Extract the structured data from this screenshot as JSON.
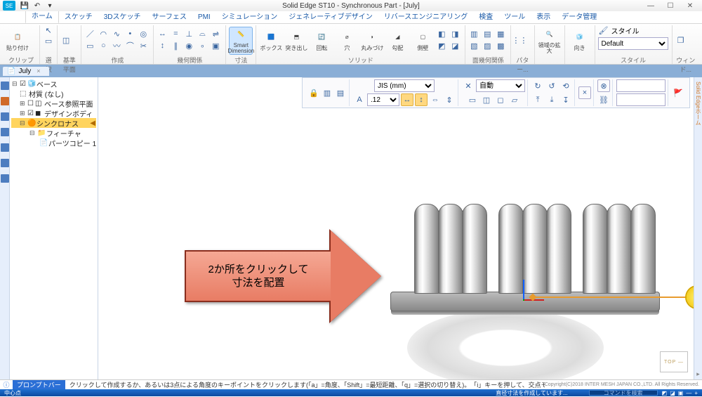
{
  "window": {
    "title": "Solid Edge ST10 - Synchronous Part - [July]",
    "min": "—",
    "max": "☐",
    "close": "✕"
  },
  "qat": {
    "save": "💾",
    "undo": "↶",
    "redo": "↷",
    "more": "▾"
  },
  "tabs": {
    "items": [
      "ホーム",
      "スケッチ",
      "3Dスケッチ",
      "サーフェス",
      "PMI",
      "シミュレーション",
      "ジェネレーティブデザイン",
      "リバースエンジニアリング",
      "検査",
      "ツール",
      "表示",
      "データ管理"
    ],
    "active": 0
  },
  "ribbon": {
    "groups": {
      "clipboard": {
        "label": "クリップボード",
        "big": "貼り付け"
      },
      "select": {
        "label": "選択"
      },
      "plane": {
        "label": "基準平面"
      },
      "create": {
        "label": "作成"
      },
      "georel": {
        "label": "幾何関係"
      },
      "dim": {
        "label": "寸法",
        "big": "Smart Dimension"
      },
      "solid": {
        "label": "ソリッド",
        "b1": "ボックス",
        "b2": "突き出し",
        "b3": "回転",
        "b4": "穴",
        "b5": "丸みづけ",
        "b6": "勾配",
        "b7": "側壁"
      },
      "facerel": {
        "label": "面幾何関係"
      },
      "pattern": {
        "label": "パター..."
      },
      "section": {
        "label": "領域の拡大"
      },
      "orient": {
        "label": "向き"
      },
      "style": {
        "label": "スタイル",
        "hdr": "スタイル",
        "val": "Default"
      },
      "window": {
        "label": "ウィンド..."
      }
    }
  },
  "doctab": {
    "name": "July",
    "open": "📄"
  },
  "tree": {
    "r0": "ベース",
    "r1": "材質 (なし)",
    "r2": "ベース参照平面",
    "r3": "デザインボディ",
    "r4": "シンクロナス",
    "r5": "フィーチャ",
    "r6": "パーツコピー 1"
  },
  "optbar": {
    "std": "JIS (mm)",
    "auto": "自動",
    "ht": ".12"
  },
  "callout": {
    "l1": "2か所をクリックして",
    "l2": "寸法を配置"
  },
  "viewcube": "TOP —",
  "prompt": {
    "label": "プロンプトバー",
    "msg": "クリックして作成するか、あるいは3点による角度のキーポイントをクリックします(「a」=角度、「Shift」=最短距離、「q」=選択の切り替え)。　「i」キーを押して、交点モードに切り替えます。",
    "copy": "Copyright(C)2018 INTER MESH JAPAN CO.,LTD. All Rights Reserved."
  },
  "status": {
    "left": "中心点",
    "mid": "直径寸法を作成しています...",
    "hint": "コマンドを検索",
    "right": ""
  }
}
